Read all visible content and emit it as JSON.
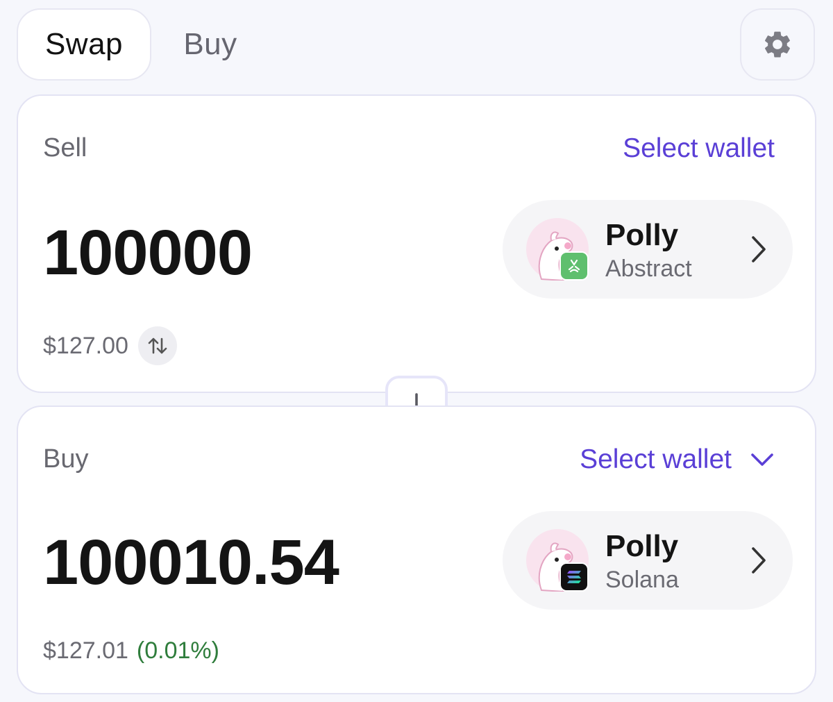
{
  "tabs": {
    "swap_label": "Swap",
    "buy_label": "Buy",
    "active": "Swap"
  },
  "settings": {
    "icon": "gear-icon"
  },
  "sell": {
    "label": "Sell",
    "select_wallet_label": "Select wallet",
    "amount": "100000",
    "fiat_value": "$127.00",
    "token": {
      "name": "Polly",
      "chain": "Abstract",
      "chain_badge_color": "#5fbf6e"
    }
  },
  "buy": {
    "label": "Buy",
    "select_wallet_label": "Select wallet",
    "amount": "100010.54",
    "fiat_value": "$127.01",
    "price_change": "(0.01%)",
    "price_change_color": "#2f7d3c",
    "token": {
      "name": "Polly",
      "chain": "Solana",
      "chain_badge_color": "#111111"
    }
  },
  "colors": {
    "accent": "#5a3fd6",
    "background": "#f6f7fc",
    "card_border": "#e3e3f3"
  }
}
